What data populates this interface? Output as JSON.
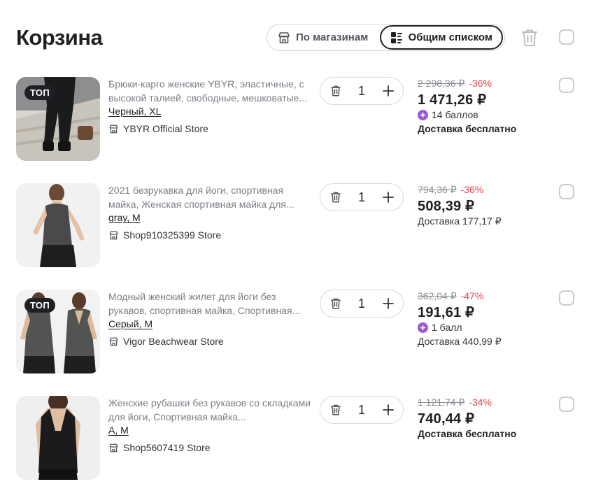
{
  "header": {
    "title": "Корзина",
    "view_by_store": "По магазинам",
    "view_list": "Общим списком"
  },
  "colors": {
    "discount": "#e0454c",
    "points": "#9b59d8",
    "text": "#1f2024"
  },
  "items": [
    {
      "badge": "ТОП",
      "title": "Брюки-карго женские YBYR, эластичные, с высокой талией, свободные, мешковатые...",
      "variant": "Черный, XL",
      "store": "YBYR Official Store",
      "qty": "1",
      "old_price": "2 298,36 ₽",
      "discount": "-36%",
      "price": "1 471,26 ₽",
      "points": "14 баллов",
      "delivery": "Доставка бесплатно"
    },
    {
      "title": "2021 безрукавка для йоги, спортивная майка, Женская спортивная майка для...",
      "variant": "gray, M",
      "store": "Shop910325399 Store",
      "qty": "1",
      "old_price": "794,36 ₽",
      "discount": "-36%",
      "price": "508,39 ₽",
      "delivery": "Доставка 177,17 ₽"
    },
    {
      "badge": "ТОП",
      "title": "Модный женский жилет для йоги без рукавов, спортивная майка, Спортивная...",
      "variant": "Серый, M",
      "store": "Vigor Beachwear Store",
      "qty": "1",
      "old_price": "362,04 ₽",
      "discount": "-47%",
      "price": "191,61 ₽",
      "points": "1 балл",
      "delivery": "Доставка 440,99 ₽"
    },
    {
      "title": "Женские рубашки без рукавов со складками для йоги, Спортивная майка...",
      "variant": "A, M",
      "store": "Shop5607419 Store",
      "qty": "1",
      "old_price": "1 121,74 ₽",
      "discount": "-34%",
      "price": "740,44 ₽",
      "delivery": "Доставка бесплатно"
    }
  ]
}
